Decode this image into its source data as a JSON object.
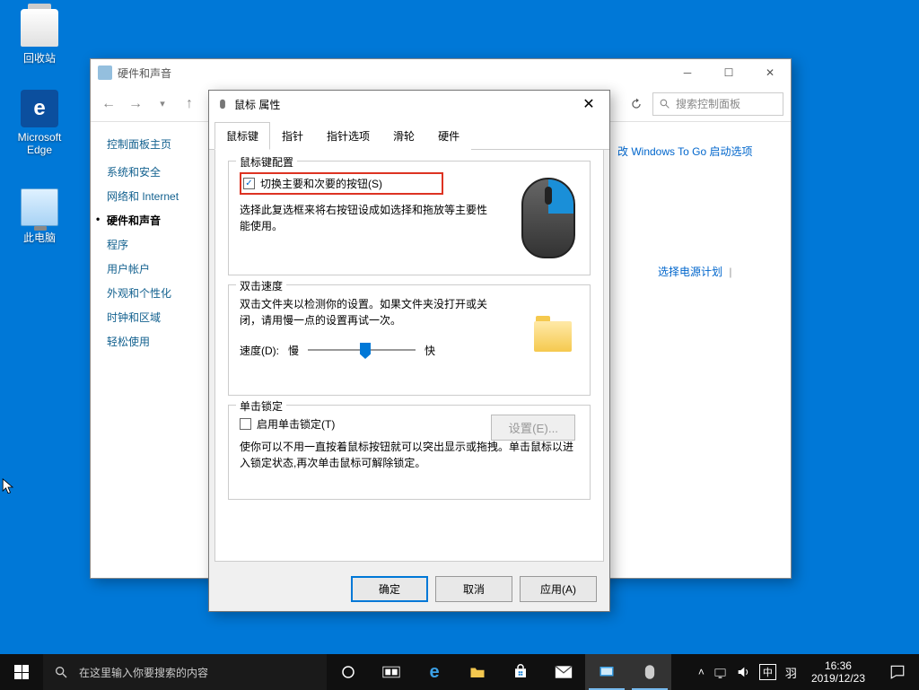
{
  "desktop": {
    "recycle": "回收站",
    "edge": "Microsoft Edge",
    "pc": "此电脑"
  },
  "cp": {
    "title": "硬件和声音",
    "search_placeholder": "搜索控制面板",
    "sidebar": {
      "heading": "控制面板主页",
      "links": [
        "系统和安全",
        "网络和 Internet",
        "硬件和声音",
        "程序",
        "用户帐户",
        "外观和个性化",
        "时钟和区域",
        "轻松使用"
      ]
    },
    "right1": "改 Windows To Go 启动选项",
    "right2": "选择电源计划"
  },
  "dlg": {
    "title": "鼠标 属性",
    "tabs": [
      "鼠标键",
      "指针",
      "指针选项",
      "滑轮",
      "硬件"
    ],
    "g1": {
      "legend": "鼠标键配置",
      "checkbox": "切换主要和次要的按钮(S)",
      "help": "选择此复选框来将右按钮设成如选择和拖放等主要性能使用。"
    },
    "g2": {
      "legend": "双击速度",
      "help": "双击文件夹以检测你的设置。如果文件夹没打开或关闭，请用慢一点的设置再试一次。",
      "speed_label": "速度(D):",
      "slow": "慢",
      "fast": "快"
    },
    "g3": {
      "legend": "单击锁定",
      "checkbox": "启用单击锁定(T)",
      "settings_btn": "设置(E)...",
      "help": "使你可以不用一直按着鼠标按钮就可以突出显示或拖拽。单击鼠标以进入锁定状态,再次单击鼠标可解除锁定。"
    },
    "buttons": {
      "ok": "确定",
      "cancel": "取消",
      "apply": "应用(A)"
    }
  },
  "taskbar": {
    "search_placeholder": "在这里输入你要搜索的内容",
    "ime1": "中",
    "ime2": "羽",
    "time": "16:36",
    "date": "2019/12/23"
  }
}
